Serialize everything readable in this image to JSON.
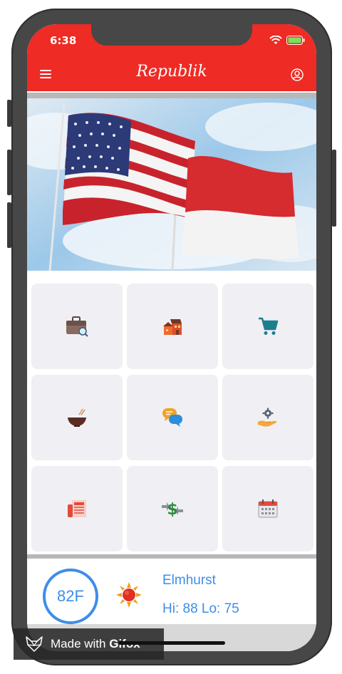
{
  "status": {
    "time": "6:38"
  },
  "header": {
    "title": "Republik"
  },
  "grid": {
    "tiles": [
      {
        "icon": "briefcase-search-icon"
      },
      {
        "icon": "houses-icon"
      },
      {
        "icon": "shopping-cart-icon"
      },
      {
        "icon": "rice-bowl-icon"
      },
      {
        "icon": "chat-bubbles-icon"
      },
      {
        "icon": "gear-hand-icon"
      },
      {
        "icon": "newspaper-icon"
      },
      {
        "icon": "money-exchange-icon"
      },
      {
        "icon": "calendar-icon"
      }
    ]
  },
  "weather": {
    "temp": "82F",
    "city": "Elmhurst",
    "hilo": "Hi: 88  Lo: 75"
  },
  "watermark": {
    "prefix": "Made with",
    "brand": "Gifox"
  },
  "colors": {
    "header": "#ee2b24",
    "accent": "#3d8ee9",
    "tile": "#f0eff3"
  }
}
